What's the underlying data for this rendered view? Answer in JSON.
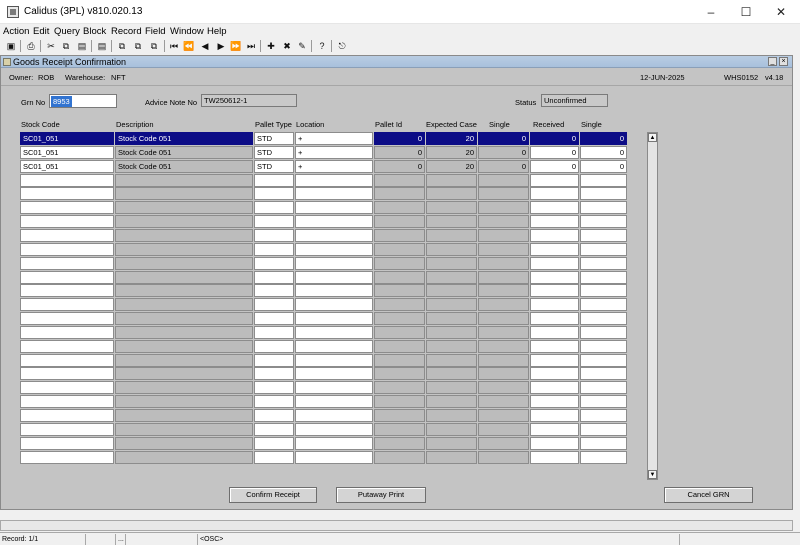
{
  "window": {
    "title": "Calidus (3PL) v810.020.13"
  },
  "menu": [
    "Action",
    "Edit",
    "Query",
    "Block",
    "Record",
    "Field",
    "Window",
    "Help"
  ],
  "form": {
    "title": "Goods Receipt Confirmation",
    "owner_label": "Owner:",
    "owner": "ROB",
    "warehouse_label": "Warehouse:",
    "warehouse": "NFT",
    "date": "12-JUN-2025",
    "module": "WHS0152",
    "version": "v4.18",
    "grn_label": "Grn No",
    "grn_value": "8953",
    "advice_label": "Advice Note No",
    "advice_value": "TW250612-1",
    "status_label": "Status",
    "status_value": "Unconfirmed"
  },
  "table": {
    "headers": [
      "Stock Code",
      "Description",
      "Pallet Type",
      "Location",
      "Pallet Id",
      "Expected Case",
      "Single",
      "Received",
      "Single"
    ],
    "rows": [
      [
        "SC01_051",
        "Stock Code 051",
        "STD",
        "+",
        "0",
        "20",
        "0",
        "0",
        "0"
      ],
      [
        "SC01_051",
        "Stock Code 051",
        "STD",
        "+",
        "0",
        "20",
        "0",
        "0",
        "0"
      ],
      [
        "SC01_051",
        "Stock Code 051",
        "STD",
        "+",
        "0",
        "20",
        "0",
        "0",
        "0"
      ]
    ]
  },
  "buttons": {
    "confirm": "Confirm Receipt",
    "putaway": "Putaway Print",
    "cancel": "Cancel GRN"
  },
  "statusbar": {
    "record": "Record: 1/1",
    "ellipsis": "...",
    "osc": "<OSC>"
  }
}
